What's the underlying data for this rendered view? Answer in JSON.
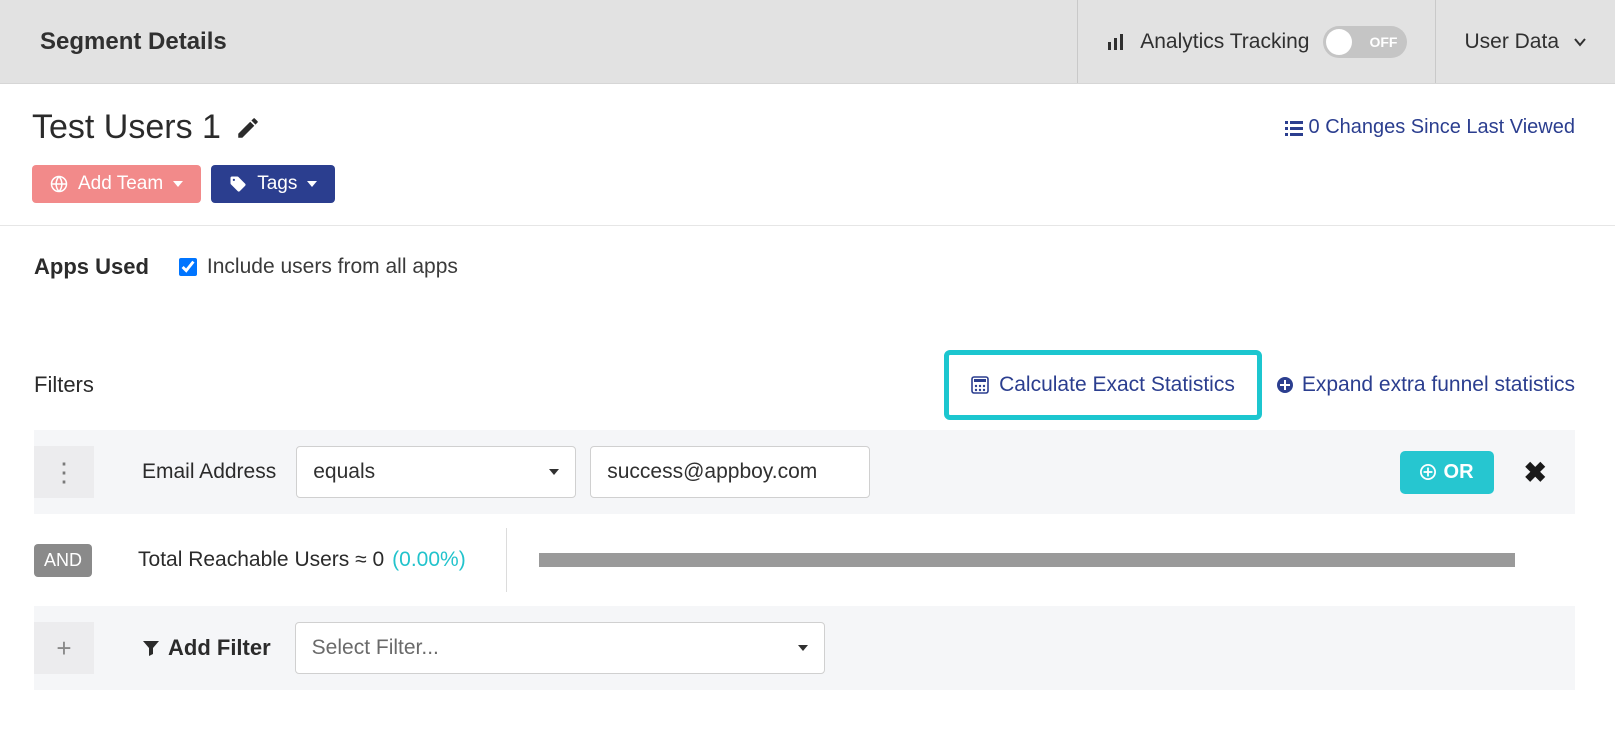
{
  "topbar": {
    "title": "Segment Details",
    "analytics_label": "Analytics Tracking",
    "toggle_state": "OFF",
    "user_data_label": "User Data"
  },
  "header": {
    "segment_name": "Test Users 1",
    "changes_link": "0 Changes Since Last Viewed",
    "add_team_label": "Add Team",
    "tags_label": "Tags"
  },
  "apps": {
    "label": "Apps Used",
    "include_label": "Include users from all apps",
    "include_checked": true
  },
  "filters": {
    "label": "Filters",
    "calc_label": "Calculate Exact Statistics",
    "expand_label": "Expand extra funnel statistics",
    "row": {
      "field": "Email Address",
      "operator": "equals",
      "value": "success@appboy.com",
      "or_label": "OR"
    },
    "and_label": "AND",
    "reach_label": "Total Reachable Users ≈ 0",
    "reach_pct": "(0.00%)",
    "add_filter_label": "Add Filter",
    "select_placeholder": "Select Filter..."
  }
}
